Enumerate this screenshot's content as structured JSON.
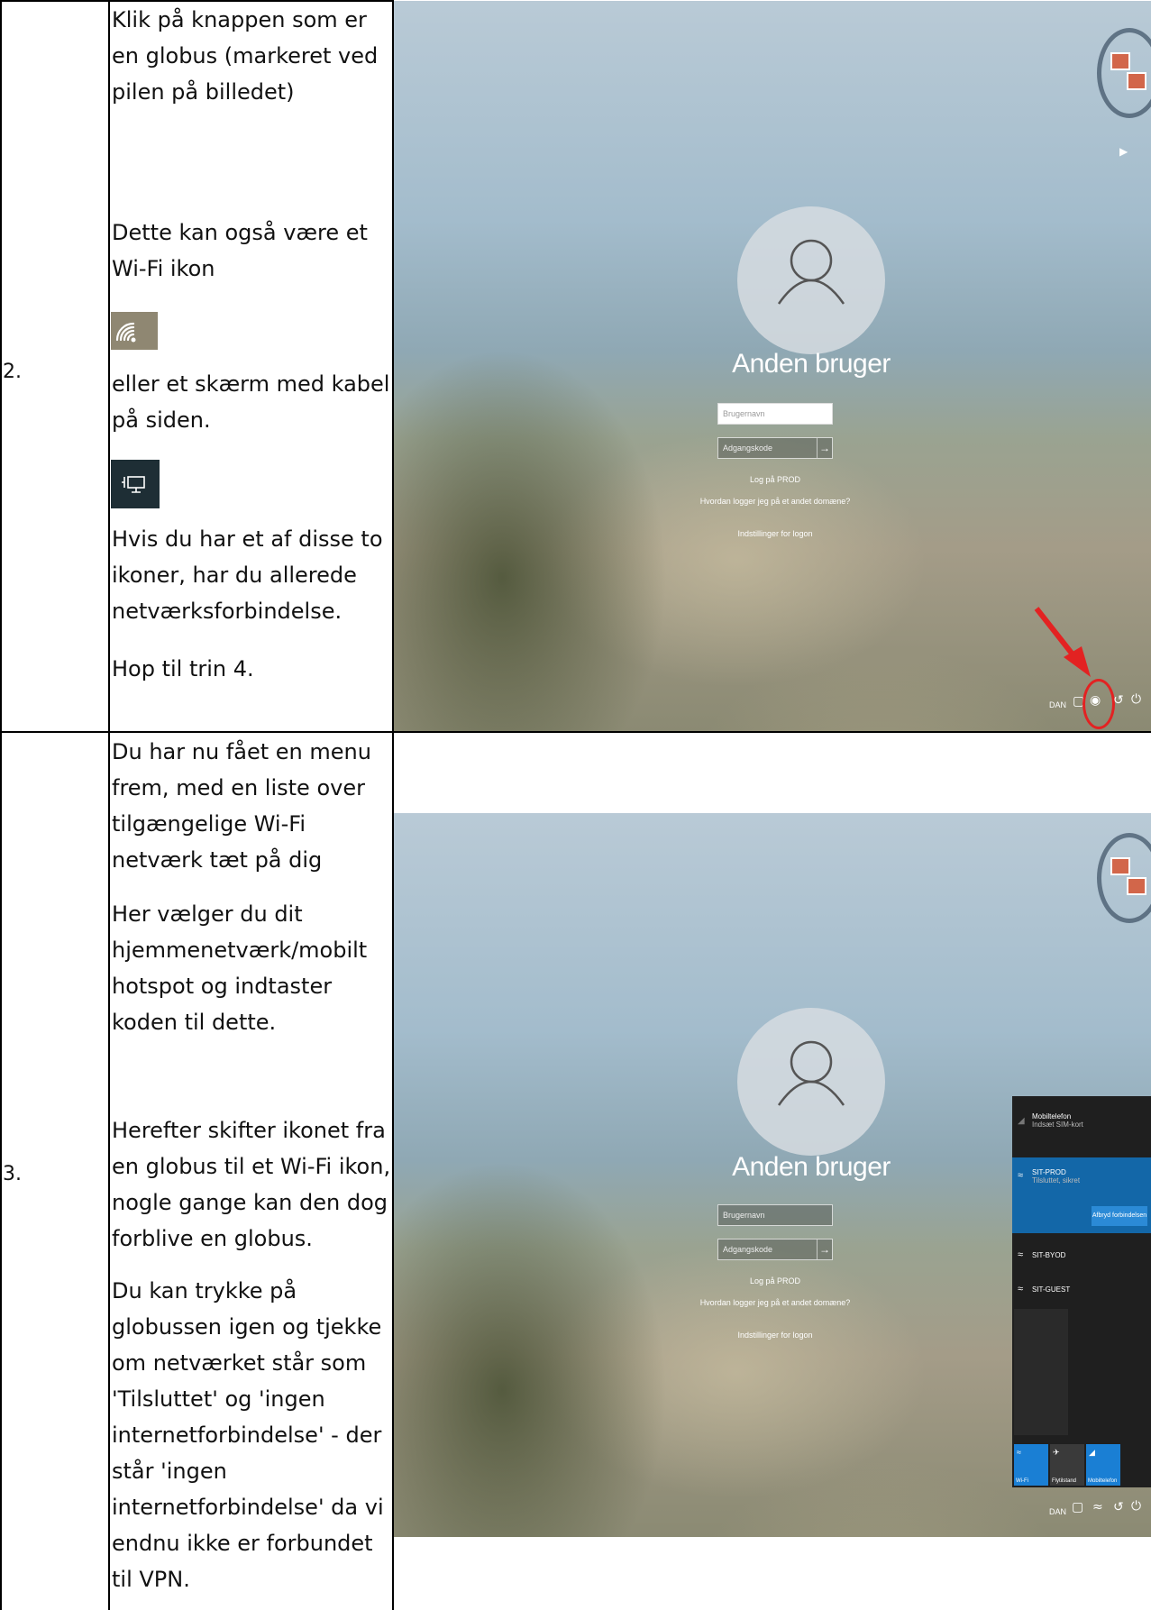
{
  "rows": [
    {
      "number": "2.",
      "paragraphs": [
        "Klik på knappen som er en globus (markeret ved pilen på billedet)",
        "Dette kan også være et Wi-Fi ikon",
        "eller et skærm med kabel på siden.",
        "Hvis du har et af disse to ikoner, har du allerede netværksforbindelse.",
        "Hop til trin 4."
      ],
      "icons": [
        "wifi-icon",
        "wired-network-icon"
      ],
      "screenshot": {
        "user_name": "Anden bruger",
        "username_placeholder": "Brugernavn",
        "password_placeholder": "Adgangskode",
        "logon_to": "Log på PROD",
        "other_domain": "Hvordan logger jeg på et andet domæne?",
        "logon_settings": "Indstillinger for logon",
        "language": "DAN",
        "highlight_color": "#e32222",
        "tray_icons": [
          "monitor-icon",
          "globe-icon",
          "accessibility-icon",
          "power-icon"
        ]
      }
    },
    {
      "number": "3.",
      "paragraphs": [
        "Du har nu fået en menu frem, med en liste over tilgængelige Wi-Fi netværk tæt på dig",
        "Her vælger du dit hjemmenetværk/mobilt hotspot og indtaster koden til dette.",
        "Herefter skifter ikonet fra en globus til et Wi-Fi ikon, nogle gange kan den dog forblive en globus.",
        "Du kan trykke på globussen igen og tjekke om netværket står som 'Tilsluttet' og 'ingen internetforbindelse' - der står 'ingen internetforbindelse' da vi endnu ikke er forbundet til VPN."
      ],
      "screenshot": {
        "user_name": "Anden bruger",
        "username_placeholder": "Brugernavn",
        "password_placeholder": "Adgangskode",
        "logon_to": "Log på PROD",
        "other_domain": "Hvordan logger jeg på et andet domæne?",
        "logon_settings": "Indstillinger for logon",
        "language": "DAN",
        "flyout": {
          "mobile_title": "Mobiltelefon",
          "mobile_sub": "Indsæt SIM-kort",
          "networks": [
            {
              "name": "SIT-PROD",
              "status": "Tilsluttet, sikret"
            },
            {
              "name": "SIT-BYOD",
              "status": ""
            },
            {
              "name": "SIT-GUEST",
              "status": ""
            }
          ],
          "disconnect_label": "Afbryd forbindelsen",
          "tiles": [
            "Wi-Fi",
            "Flytilstand",
            "Mobiltelefon"
          ]
        },
        "tray_icons": [
          "monitor-icon",
          "wifi-icon",
          "accessibility-icon",
          "power-icon"
        ]
      }
    }
  ],
  "colors": {
    "wifi_tile_bg": "#8f8772",
    "wired_tile_bg": "#1e2e35",
    "selected_network": "#1367a8",
    "tile_blue": "#1a7fd4"
  }
}
